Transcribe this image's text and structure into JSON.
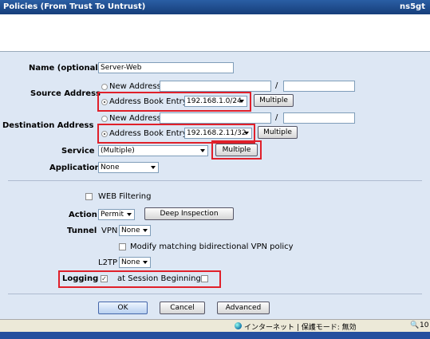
{
  "window": {
    "title": "Policies (From Trust To Untrust)",
    "device": "ns5gt"
  },
  "form": {
    "name_label": "Name (optional)",
    "name_value": "Server-Web",
    "source_label": "Source Address",
    "source_new_label": "New Address",
    "source_new_value": "",
    "source_mask_value": "",
    "source_book_label": "Address Book Entry",
    "source_book_value": "192.168.1.0/24",
    "source_multiple": "Multiple",
    "dest_label": "Destination Address",
    "dest_new_label": "New Address",
    "dest_new_value": "",
    "dest_mask_value": "",
    "dest_book_label": "Address Book Entry",
    "dest_book_value": "192.168.2.11/32",
    "dest_multiple": "Multiple",
    "service_label": "Service",
    "service_value": "(Multiple)",
    "service_multiple": "Multiple",
    "application_label": "Application",
    "application_value": "None",
    "web_filtering_label": "WEB Filtering",
    "action_label": "Action",
    "action_value": "Permit",
    "deep_inspection": "Deep Inspection",
    "tunnel_label": "Tunnel",
    "vpn_label": "VPN",
    "vpn_value": "None",
    "modify_vpn_label": "Modify matching bidirectional VPN policy",
    "l2tp_label": "L2TP",
    "l2tp_value": "None",
    "logging_label": "Logging",
    "session_begin_label": "at Session Beginning",
    "slash": "/"
  },
  "buttons": {
    "ok": "OK",
    "cancel": "Cancel",
    "advanced": "Advanced"
  },
  "status": {
    "zone_text": "インターネット | 保護モード: 無効",
    "zoom": "10"
  },
  "colors": {
    "title_bg": "#163e7a",
    "form_bg": "#dde7f4",
    "highlight": "#e0202a"
  }
}
